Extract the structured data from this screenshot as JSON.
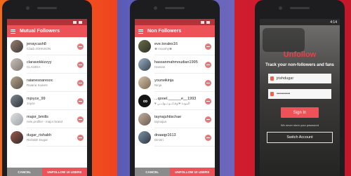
{
  "screen1": {
    "time": "",
    "title": "Mutual Followers",
    "users": [
      {
        "username": "jenaycash8",
        "fullname": "Cả𝓴ả JOHNSON"
      },
      {
        "username": "claravekkizzyy",
        "fullname": "CLAUDIA"
      },
      {
        "username": "raianesoaresoc",
        "fullname": "Raiana Soares"
      },
      {
        "username": "mjoyce_99",
        "fullname": "Joyce"
      },
      {
        "username": "major_bmills",
        "fullname": "new profile! - major brand"
      },
      {
        "username": "dugar_rishabh",
        "fullname": "Rishabh Dugar"
      }
    ],
    "cancel_label": "CANCEL",
    "unfollow_all_label": "UNFOLLOW 10 USERS"
  },
  "screen2": {
    "time": "",
    "title": "Non Followers",
    "users": [
      {
        "username": "eve.torales16",
        "fullname": "♚ mooshy♚"
      },
      {
        "username": "hassanmahmoudian1995",
        "fullname": "Hassan"
      },
      {
        "username": "yourwikinja",
        "fullname": "Ninja"
      },
      {
        "username": "...qooel.______e__1993",
        "fullname": "♥ ألمودة ♥اوقـاتــو بــهايــي"
      },
      {
        "username": "taynajuhtischae",
        "fullname": "taynajua"
      },
      {
        "username": "dnaaqp1613",
        "fullname": "Dimitri"
      }
    ],
    "cancel_label": "CANCEL",
    "unfollow_all_label": "UNFOLLOW 10 USERS"
  },
  "screen3": {
    "time": "4:14",
    "brand": "Unfollow",
    "tagline": "Track your non-followers and fans",
    "username_value": "jrishdugar",
    "password_value": "••••••••••",
    "sign_in_label": "Sign In",
    "note": "We never store your password",
    "switch_label": "Switch Account"
  }
}
